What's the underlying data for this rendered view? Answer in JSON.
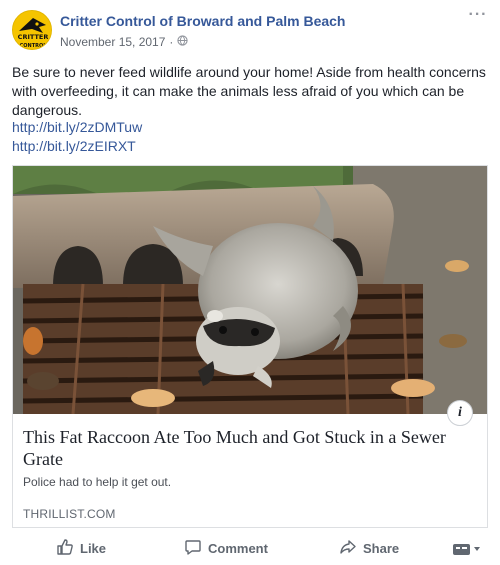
{
  "post": {
    "page_name": "Critter Control of Broward and Palm Beach",
    "date": "November 15, 2017",
    "separator": "·",
    "audience_icon": "globe-icon",
    "more_label": "···",
    "avatar_text": "CRITTER CONTROL",
    "message": "Be sure to never feed wildlife around your home! Aside from health concerns with overfeeding, it can make the animals less afraid of you which can be dangerous.",
    "links": [
      "http://bit.ly/2zDMTuw",
      "http://bit.ly/2zEIRXT"
    ]
  },
  "card": {
    "title": "This Fat Raccoon Ate Too Much and Got Stuck in a Sewer Grate",
    "description": "Police had to help it get out.",
    "domain": "THRILLIST.COM",
    "info_label": "i"
  },
  "actions": {
    "like": "Like",
    "comment": "Comment",
    "share": "Share"
  },
  "colors": {
    "link": "#365899",
    "meta": "#616770",
    "text": "#1d2129",
    "avatar": "#f5c400"
  }
}
